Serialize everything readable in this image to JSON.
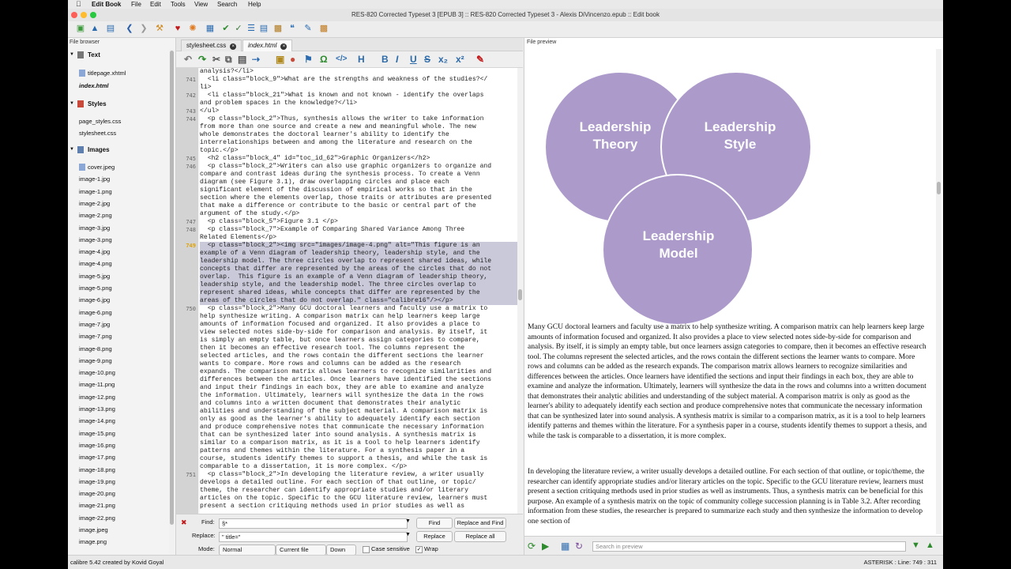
{
  "menubar": {
    "app_name": "Edit Book",
    "items": [
      "File",
      "Edit",
      "Tools",
      "View",
      "Search",
      "Help"
    ]
  },
  "window": {
    "title": "RES-820 Corrected Typeset 3 [EPUB 3] :: RES-820 Corrected Typeset 3 - Alexis DiVincenzo.epub :: Edit book"
  },
  "file_browser": {
    "title": "File browser",
    "categories": {
      "text": "Text",
      "styles": "Styles",
      "images": "Images"
    },
    "text_files": [
      "titlepage.xhtml",
      "index.html"
    ],
    "style_files": [
      "page_styles.css",
      "stylesheet.css"
    ],
    "image_files": [
      "cover.jpeg",
      "image-1.jpg",
      "image-1.png",
      "image-2.jpg",
      "image-2.png",
      "image-3.jpg",
      "image-3.png",
      "image-4.jpg",
      "image-4.png",
      "image-5.jpg",
      "image-5.png",
      "image-6.jpg",
      "image-6.png",
      "image-7.jpg",
      "image-7.png",
      "image-8.png",
      "image-9.png",
      "image-10.png",
      "image-11.png",
      "image-12.png",
      "image-13.png",
      "image-14.png",
      "image-15.png",
      "image-16.png",
      "image-17.png",
      "image-18.png",
      "image-19.png",
      "image-20.png",
      "image-21.png",
      "image-22.png",
      "image.jpeg",
      "image.png"
    ]
  },
  "editor": {
    "tabs": [
      "stylesheet.css",
      "index.html"
    ],
    "active_tab": "index.html",
    "line_numbers": [
      {
        "n": "741",
        "row": 1
      },
      {
        "n": "742",
        "row": 3
      },
      {
        "n": "743",
        "row": 5
      },
      {
        "n": "744",
        "row": 6
      },
      {
        "n": "745",
        "row": 11
      },
      {
        "n": "746",
        "row": 12
      },
      {
        "n": "747",
        "row": 19
      },
      {
        "n": "748",
        "row": 20
      },
      {
        "n": "749",
        "row": 22
      },
      {
        "n": "750",
        "row": 30
      },
      {
        "n": "751",
        "row": 51
      }
    ],
    "lines": [
      "analysis?</li>",
      "  <li class=\"block_9\">What are the strengths and weakness of the studies?</",
      "li>",
      "  <li class=\"block_21\">What is known and not known - identify the overlaps",
      "and problem spaces in the knowledge?</li>",
      "</ul>",
      "  <p class=\"block_2\">Thus, synthesis allows the writer to take information",
      "from more than one source and create a new and meaningful whole. The new",
      "whole demonstrates the doctoral learner's ability to identify the",
      "interrelationships between and among the literature and research on the",
      "topic.</p>",
      "  <h2 class=\"block_4\" id=\"toc_id_62\">Graphic Organizers</h2>",
      "  <p class=\"block_2\">Writers can also use graphic organizers to organize and",
      "compare and contrast ideas during the synthesis process. To create a Venn",
      "diagram (see Figure 3.1), draw overlapping circles and place each",
      "significant element of the discussion of empirical works so that in the",
      "section where the elements overlap, those traits or attributes are presented",
      "that make a difference or contribute to the basic or central part of the",
      "argument of the study.</p>",
      "  <p class=\"block_5\">Figure 3.1 </p>",
      "  <p class=\"block_7\">Example of Comparing Shared Variance Among Three",
      "Related Elements</p>",
      "  <p class=\"block_2\"><img src=\"images/image-4.png\" alt=\"This figure is an",
      "example of a Venn diagram of leadership theory, leadership style, and the",
      "leadership model. The three circles overlap to represent shared ideas, while",
      "concepts that differ are represented by the areas of the circles that do not",
      "overlap.  This figure is an example of a Venn diagram of leadership theory,",
      "leadership style, and the leadership model. The three circles overlap to",
      "represent shared ideas, while concepts that differ are represented by the",
      "areas of the circles that do not overlap.\" class=\"calibre16\"/></p>",
      "  <p class=\"block_2\">Many GCU doctoral learners and faculty use a matrix to",
      "help synthesize writing. A comparison matrix can help learners keep large",
      "amounts of information focused and organized. It also provides a place to",
      "view selected notes side-by-side for comparison and analysis. By itself, it",
      "is simply an empty table, but once learners assign categories to compare,",
      "then it becomes an effective research tool. The columns represent the",
      "selected articles, and the rows contain the different sections the learner",
      "wants to compare. More rows and columns can be added as the research",
      "expands. The comparison matrix allows learners to recognize similarities and",
      "differences between the articles. Once learners have identified the sections",
      "and input their findings in each box, they are able to examine and analyze",
      "the information. Ultimately, learners will synthesize the data in the rows",
      "and columns into a written document that demonstrates their analytic",
      "abilities and understanding of the subject material. A comparison matrix is",
      "only as good as the learner's ability to adequately identify each section",
      "and produce comprehensive notes that communicate the necessary information",
      "that can be synthesized later into sound analysis. A synthesis matrix is",
      "similar to a comparison matrix, as it is a tool to help learners identify",
      "patterns and themes within the literature. For a synthesis paper in a",
      "course, students identify themes to support a thesis, and while the task is",
      "comparable to a dissertation, it is more complex. </p>",
      "  <p class=\"block_2\">In developing the literature review, a writer usually",
      "develops a detailed outline. For each section of that outline, or topic/",
      "theme, the researcher can identify appropriate studies and/or literary",
      "articles on the topic. Specific to the GCU literature review, learners must",
      "present a section critiquing methods used in prior studies as well as"
    ]
  },
  "find_replace": {
    "find_label": "Find:",
    "find_value": "§*",
    "replace_label": "Replace:",
    "replace_value": "\" title=\"",
    "find_button": "Find",
    "replace_find_button": "Replace and Find",
    "replace_button": "Replace",
    "replace_all_button": "Replace all",
    "mode_label": "Mode:",
    "mode_value": "Normal",
    "scope_value": "Current file",
    "direction_value": "Down",
    "case_sensitive_label": "Case sensitive",
    "wrap_label": "Wrap"
  },
  "preview": {
    "title": "File preview",
    "venn": {
      "circle_a": [
        "Leadership",
        "Theory"
      ],
      "circle_b": [
        "Leadership",
        "Style"
      ],
      "circle_c": [
        "Leadership",
        "Model"
      ],
      "color": "#9b84c0"
    },
    "paragraph_1": "Many GCU doctoral learners and faculty use a matrix to help synthesize writing. A comparison matrix can help learners keep large amounts of information focused and organized. It also provides a place to view selected notes side-by-side for comparison and analysis. By itself, it is simply an empty table, but once learners assign categories to compare, then it becomes an effective research tool. The columns represent the selected articles, and the rows contain the different sections the learner wants to compare. More rows and columns can be added as the research expands. The comparison matrix allows learners to recognize similarities and differences between the articles. Once learners have identified the sections and input their findings in each box, they are able to examine and analyze the information. Ultimately, learners will synthesize the data in the rows and columns into a written document that demonstrates their analytic abilities and understanding of the subject material. A comparison matrix is only as good as the learner's ability to adequately identify each section and produce comprehensive notes that communicate the necessary information that can be synthesized later into sound analysis. A synthesis matrix is similar to a comparison matrix, as it is a tool to help learners identify patterns and themes within the literature. For a synthesis paper in a course, students identify themes to support a thesis, and while the task is comparable to a dissertation, it is more complex.",
    "paragraph_2": "In developing the literature review, a writer usually develops a detailed outline. For each section of that outline, or topic/theme, the researcher can identify appropriate studies and/or literary articles on the topic. Specific to the GCU literature review, learners must present a section critiquing methods used in prior studies as well as instruments. Thus, a synthesis matrix can be beneficial for this purpose. An example of a synthesis matrix on the topic of community college succession planning is in Table 3.2. After recording information from these studies, the researcher is prepared to summarize each study and then synthesize the information to develop one section of",
    "search_placeholder": "Search in preview"
  },
  "status": {
    "left": "calibre 5.42 created by Kovid Goyal",
    "right": "ASTERISK : Line: 749 : 311"
  }
}
